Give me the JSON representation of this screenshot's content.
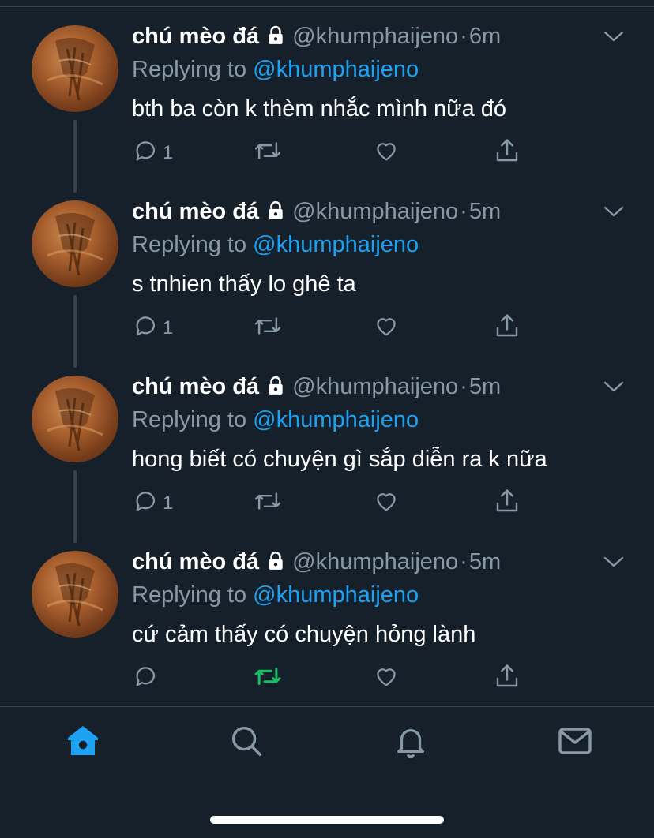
{
  "colors": {
    "background": "#15202b",
    "divider": "#38444d",
    "secondary_text": "#8899a6",
    "link": "#1da1f2",
    "retweet_active": "#17bf63",
    "primary_text": "#ffffff"
  },
  "tweets": [
    {
      "name": "chú mèo đá",
      "handle": "@khumphaijeno",
      "dot": "·",
      "time": "6m",
      "reply_prefix": "Replying to ",
      "reply_to": "@khumphaijeno",
      "text": "bth ba còn k thèm nhắc mình nữa đó",
      "reply_count": "1",
      "retweeted": false
    },
    {
      "name": "chú mèo đá",
      "handle": "@khumphaijeno",
      "dot": "·",
      "time": "5m",
      "reply_prefix": "Replying to ",
      "reply_to": "@khumphaijeno",
      "text": "s tnhien thấy lo ghê ta",
      "reply_count": "1",
      "retweeted": false
    },
    {
      "name": "chú mèo đá",
      "handle": "@khumphaijeno",
      "dot": "·",
      "time": "5m",
      "reply_prefix": "Replying to ",
      "reply_to": "@khumphaijeno",
      "text": "hong biết có chuyện gì sắp diễn ra k nữa",
      "reply_count": "1",
      "retweeted": false
    },
    {
      "name": "chú mèo đá",
      "handle": "@khumphaijeno",
      "dot": "·",
      "time": "5m",
      "reply_prefix": "Replying to ",
      "reply_to": "@khumphaijeno",
      "text": "cứ cảm thấy có chuyện hỏng lành",
      "reply_count": "",
      "retweeted": true
    }
  ],
  "tabbar": {
    "items": [
      {
        "icon": "home-icon",
        "active": true
      },
      {
        "icon": "search-icon",
        "active": false
      },
      {
        "icon": "bell-icon",
        "active": false
      },
      {
        "icon": "mail-icon",
        "active": false
      }
    ]
  }
}
